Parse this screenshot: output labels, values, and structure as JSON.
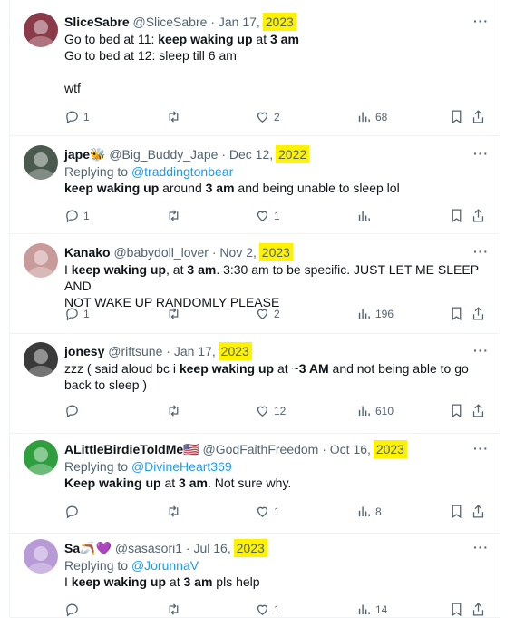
{
  "tweets": [
    {
      "name": "SliceSabre",
      "name_emoji": "",
      "handle": "@SliceSabre",
      "sep": "·",
      "date": "Jan 17,",
      "year": "2023",
      "replying_prefix": "",
      "replying_to": "",
      "lines": [
        [
          {
            "t": "Go to bed at 11:  ",
            "b": false
          },
          {
            "t": "keep waking up",
            "b": true
          },
          {
            "t": " at ",
            "b": false
          },
          {
            "t": "3 am",
            "b": true
          }
        ],
        [
          {
            "t": "Go to bed at 12: sleep till 6 am",
            "b": false
          }
        ],
        [
          {
            "t": "",
            "b": false
          }
        ],
        [
          {
            "t": "wtf",
            "b": false
          }
        ]
      ],
      "replies": "1",
      "retweets": "",
      "likes": "2",
      "views": "68",
      "avatar_color": "#8b3a4a"
    },
    {
      "name": "jape",
      "name_emoji": "🐝",
      "handle": "@Big_Buddy_Jape",
      "sep": "·",
      "date": "Dec 12,",
      "year": "2022",
      "replying_prefix": "Replying to ",
      "replying_to": "@traddingtonbear",
      "lines": [
        [
          {
            "t": "keep waking up",
            "b": true
          },
          {
            "t": " around ",
            "b": false
          },
          {
            "t": "3 am",
            "b": true
          },
          {
            "t": " and being unable to sleep lol",
            "b": false
          }
        ]
      ],
      "replies": "1",
      "retweets": "",
      "likes": "1",
      "views": "",
      "avatar_color": "#4a5a4e"
    },
    {
      "name": "Kanako",
      "name_emoji": "",
      "handle": "@babydoll_lover",
      "sep": "·",
      "date": "Nov 2,",
      "year": "2023",
      "replying_prefix": "",
      "replying_to": "",
      "lines": [
        [
          {
            "t": "I ",
            "b": false
          },
          {
            "t": "keep waking up",
            "b": true
          },
          {
            "t": ", at ",
            "b": false
          },
          {
            "t": "3 am",
            "b": true
          },
          {
            "t": ". 3:30 am to be specific. JUST LET ME SLEEP AND",
            "b": false
          }
        ],
        [
          {
            "t": "NOT WAKE UP RANDOMLY PLEASE",
            "b": false
          }
        ]
      ],
      "replies": "1",
      "retweets": "",
      "likes": "2",
      "views": "196",
      "avatar_color": "#c99a9a"
    },
    {
      "name": "jonesy",
      "name_emoji": "",
      "handle": "@riftsune",
      "sep": "·",
      "date": "Jan 17,",
      "year": "2023",
      "replying_prefix": "",
      "replying_to": "",
      "lines": [
        [
          {
            "t": "zzz ( said aloud bc i ",
            "b": false
          },
          {
            "t": "keep waking up",
            "b": true
          },
          {
            "t": " at ~",
            "b": false
          },
          {
            "t": "3 AM",
            "b": true
          },
          {
            "t": " and not being able to go",
            "b": false
          }
        ],
        [
          {
            "t": "back to sleep )",
            "b": false
          }
        ]
      ],
      "replies": "",
      "retweets": "",
      "likes": "12",
      "views": "610",
      "avatar_color": "#3a3a3a"
    },
    {
      "name": "ALittleBirdieToldMe",
      "name_emoji": "🇺🇸",
      "handle": "@GodFaithFreedom",
      "sep": "·",
      "date": "Oct 16,",
      "year": "2023",
      "replying_prefix": "Replying to ",
      "replying_to": "@DivineHeart369",
      "lines": [
        [
          {
            "t": "Keep waking up",
            "b": true
          },
          {
            "t": " at ",
            "b": false
          },
          {
            "t": "3 am",
            "b": true
          },
          {
            "t": ". Not sure why.",
            "b": false
          }
        ]
      ],
      "replies": "",
      "retweets": "",
      "likes": "1",
      "views": "8",
      "avatar_color": "#2e9e3e"
    },
    {
      "name": "Sa",
      "name_emoji": "🪃💜",
      "handle": "@sasasori1",
      "sep": "·",
      "date": "Jul 16,",
      "year": "2023",
      "replying_prefix": "Replying to ",
      "replying_to": "@JorunnaV",
      "lines": [
        [
          {
            "t": "I ",
            "b": false
          },
          {
            "t": "keep waking up",
            "b": true
          },
          {
            "t": " at ",
            "b": false
          },
          {
            "t": "3 am",
            "b": true
          },
          {
            "t": " pls help",
            "b": false
          }
        ]
      ],
      "replies": "",
      "retweets": "",
      "likes": "1",
      "views": "14",
      "avatar_color": "#b89ad6"
    }
  ]
}
